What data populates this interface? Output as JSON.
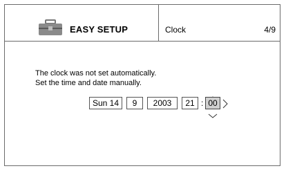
{
  "header": {
    "icon": "toolbox-icon",
    "title": "EASY SETUP",
    "section": "Clock",
    "step": "4/9"
  },
  "message": {
    "line1": "The clock was not set automatically.",
    "line2": "Set the time and date manually."
  },
  "clock": {
    "day_date": "Sun 14",
    "month": "9",
    "year": "2003",
    "hour": "21",
    "separator": ":",
    "minute": "00",
    "active_field": "minute"
  },
  "colors": {
    "border": "#6a6a6a",
    "active_field_bg": "#d0d0d0"
  }
}
